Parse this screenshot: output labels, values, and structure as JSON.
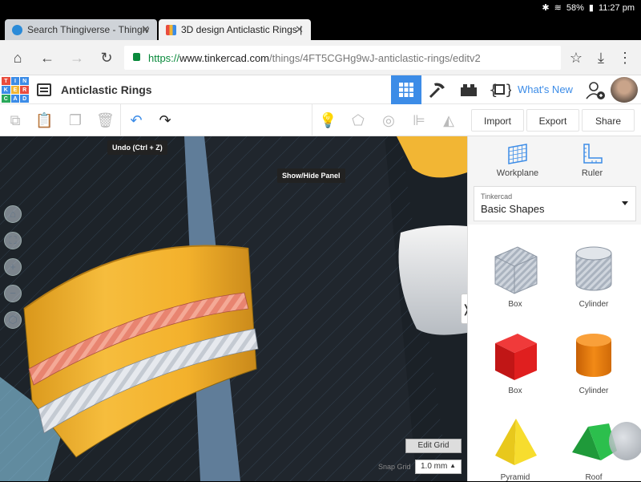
{
  "status": {
    "battery": "58%",
    "time": "11:27 pm"
  },
  "browser": {
    "tabs": [
      {
        "title": "Search Thingiverse - Thingiv",
        "active": false
      },
      {
        "title": "3D design Anticlastic Rings |",
        "active": true
      }
    ],
    "url": {
      "protocol": "https://",
      "host": "www.tinkercad.com",
      "path": "/things/4FT5CGHg9wJ-anticlastic-rings/editv2"
    }
  },
  "app": {
    "logo_letters": [
      "T",
      "I",
      "N",
      "K",
      "E",
      "R",
      "C",
      "A",
      "D"
    ],
    "design_title": "Anticlastic Rings",
    "whats_new": "What's New"
  },
  "toolbar": {
    "import": "Import",
    "export": "Export",
    "share": "Share"
  },
  "tooltips": {
    "undo": "Undo (Ctrl + Z)",
    "show_hide": "Show/Hide Panel"
  },
  "panel": {
    "workplane": "Workplane",
    "ruler": "Ruler",
    "library_provider": "Tinkercad",
    "library_name": "Basic Shapes",
    "shapes": [
      {
        "label": "Box"
      },
      {
        "label": "Cylinder"
      },
      {
        "label": "Box"
      },
      {
        "label": "Cylinder"
      },
      {
        "label": "Pyramid"
      },
      {
        "label": "Roof"
      }
    ]
  },
  "grid": {
    "edit_grid": "Edit Grid",
    "snap_label": "Snap Grid",
    "snap_value": "1.0 mm"
  },
  "colors": {
    "accent": "#3c8ce7",
    "ring_yellow": "#f2b634",
    "rope_pink": "#e88470",
    "rope_white": "#e6e9ee",
    "dark_body": "#1d2329"
  }
}
